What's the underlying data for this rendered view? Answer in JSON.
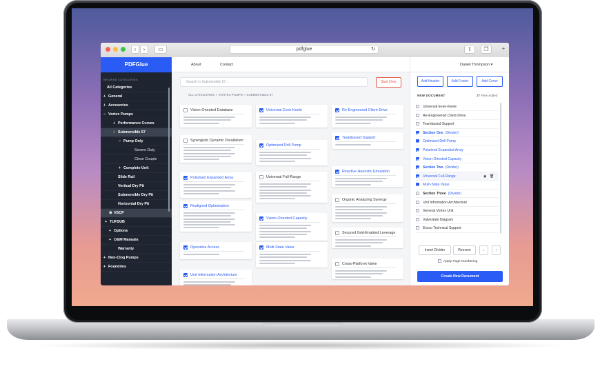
{
  "browser": {
    "url": "pdfglue",
    "back_icon": "chevron-left",
    "forward_icon": "chevron-right",
    "sidebar_icon": "sidebar-icon",
    "reload_icon": "reload-icon",
    "share_icon": "share-icon",
    "tabs_icon": "tabs-icon",
    "new_tab": "+"
  },
  "brand": "PDFGlue",
  "sidebar": {
    "heading": "BROWSE CATEGORIES",
    "items": [
      {
        "label": "All Categories",
        "prefix": ""
      },
      {
        "label": "General",
        "prefix": "+"
      },
      {
        "label": "Accesories",
        "prefix": "+"
      },
      {
        "label": "Vortex Pumps",
        "prefix": "−"
      },
      {
        "label": "Performance Curves",
        "prefix": "+"
      },
      {
        "label": "Submersible 57",
        "prefix": "−"
      },
      {
        "label": "Pump Only",
        "prefix": "−"
      },
      {
        "label": "Severe Duty",
        "prefix": ""
      },
      {
        "label": "Close Couple",
        "prefix": ""
      },
      {
        "label": "Complete Unit",
        "prefix": "+"
      },
      {
        "label": "Slide Rail",
        "prefix": ""
      },
      {
        "label": "Vertical Dry Pit",
        "prefix": ""
      },
      {
        "label": "Submersible Dry Pit",
        "prefix": ""
      },
      {
        "label": "Horizontal Dry Pit",
        "prefix": ""
      },
      {
        "label": "VSCP",
        "prefix": "⊕"
      },
      {
        "label": "TUFSUB",
        "prefix": "+"
      },
      {
        "label": "Options",
        "prefix": "+"
      },
      {
        "label": "O&M Manuals",
        "prefix": "+"
      },
      {
        "label": "Warranty",
        "prefix": ""
      },
      {
        "label": "Non-Clog Pumps",
        "prefix": "+"
      },
      {
        "label": "Foundries",
        "prefix": "+"
      }
    ]
  },
  "nav": {
    "about": "About",
    "contact": "Contact",
    "user": "Daniel Thompson"
  },
  "search": {
    "placeholder": "Search in Submersible 57..."
  },
  "start_over": "Start Over",
  "breadcrumb": "ALL CATEGORIES » VORTEX PUMPS » SUBMERSIBLE 57",
  "cards": [
    {
      "title": "Vision-Oriented Database",
      "checked": false
    },
    {
      "title": "Synergistic Dynamic Parallelism",
      "checked": false
    },
    {
      "title": "Polarised Expanded Array",
      "checked": true
    },
    {
      "title": "Realigned Optimisation",
      "checked": true
    },
    {
      "title": "Operative Access",
      "checked": true
    },
    {
      "title": "Unit Information Architecture",
      "checked": true
    },
    {
      "title": "Universal Even-Keele",
      "checked": true
    },
    {
      "title": "Optimized Drill Pump",
      "checked": true
    },
    {
      "title": "Universal Full-Range",
      "checked": false
    },
    {
      "title": "Vision-Oriented Capacity",
      "checked": true
    },
    {
      "title": "Multi-State Value",
      "checked": true
    },
    {
      "title": "Re-Engineered Client-Drive",
      "checked": true
    },
    {
      "title": "Teambased Support",
      "checked": true
    },
    {
      "title": "Reactive Heuristic Emulation",
      "checked": true
    },
    {
      "title": "Organic Analyzing Synergy",
      "checked": false
    },
    {
      "title": "Secured Grid-Enabled Leverage",
      "checked": false
    },
    {
      "title": "Cross-Platform Valve",
      "checked": false
    }
  ],
  "right": {
    "add_header": "Add Header",
    "add_footer": "Add Footer",
    "add_cover": "Add Cover",
    "new_document": "NEW DOCUMENT",
    "files_count": "27",
    "files_label": " Files Added",
    "docs": [
      {
        "label": "Universal Even-Keele",
        "checked": false,
        "divider": false
      },
      {
        "label": "Re-Engineered Client-Drive",
        "checked": false,
        "divider": false
      },
      {
        "label": "Teambased Support",
        "checked": false,
        "divider": false
      },
      {
        "label": "Section One",
        "checked": true,
        "divider": true
      },
      {
        "label": "Optimized Drill Pump",
        "checked": true,
        "divider": false
      },
      {
        "label": "Polarised Expanded Array",
        "checked": true,
        "divider": false
      },
      {
        "label": "Vision-Oriented Capacity",
        "checked": true,
        "divider": false
      },
      {
        "label": "Section Two",
        "checked": true,
        "divider": true
      },
      {
        "label": "Universal Full-Range",
        "checked": true,
        "divider": false
      },
      {
        "label": "Multi-State Value",
        "checked": true,
        "divider": false
      },
      {
        "label": "Section Three",
        "checked": false,
        "divider": true
      },
      {
        "label": "Unit Information Architecture",
        "checked": false,
        "divider": false
      },
      {
        "label": "General Vortex Unit",
        "checked": false,
        "divider": false
      },
      {
        "label": "Valvestate Diagram",
        "checked": false,
        "divider": false
      },
      {
        "label": "Essco Technical Support",
        "checked": false,
        "divider": false
      }
    ],
    "divider_tag": "(Divider)",
    "insert_divider": "Insert Divider",
    "remove": "Remove",
    "down": "↓",
    "up": "↑",
    "apply_numbering": "Apply Page Numbering",
    "create": "Create New Document"
  }
}
